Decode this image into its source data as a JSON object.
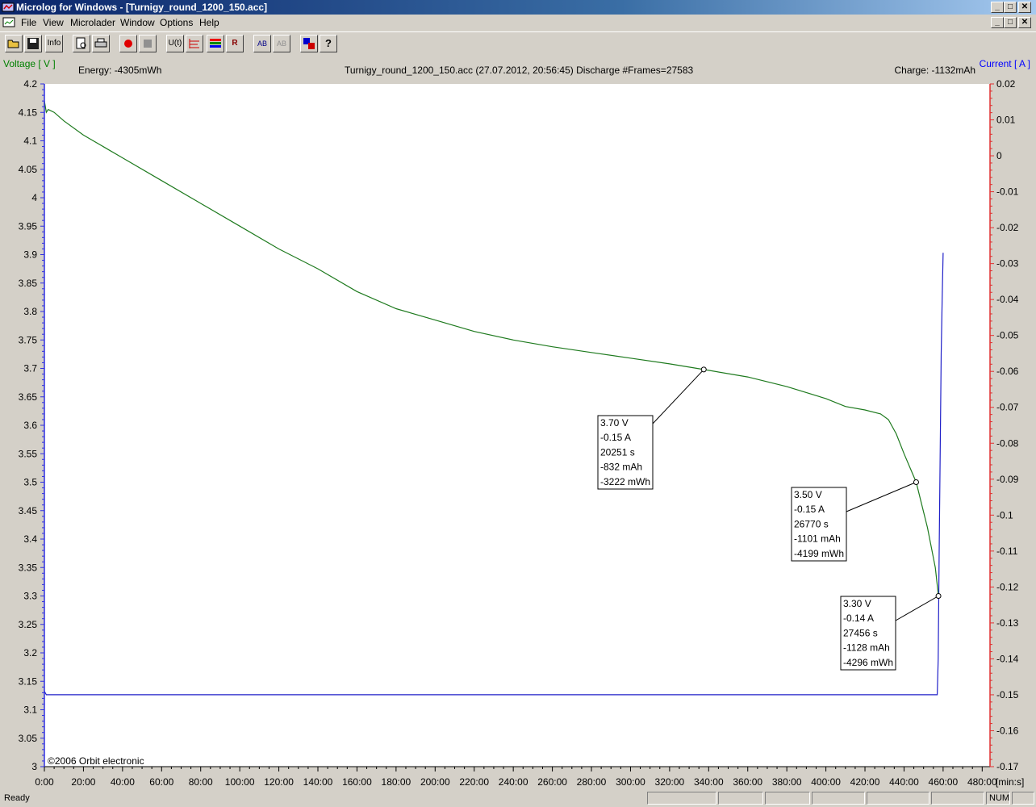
{
  "window": {
    "title": "Microlog for Windows - [Turnigy_round_1200_150.acc]",
    "title_controls": [
      "_",
      "□",
      "✕"
    ],
    "doc_controls": [
      "_",
      "□",
      "✕"
    ]
  },
  "menu": [
    {
      "label": "File",
      "name": "menu-file"
    },
    {
      "label": "View",
      "name": "menu-view"
    },
    {
      "label": "Microlader",
      "name": "menu-microlader"
    },
    {
      "label": "Window",
      "name": "menu-window"
    },
    {
      "label": "Options",
      "name": "menu-options"
    },
    {
      "label": "Help",
      "name": "menu-help"
    }
  ],
  "toolbar": [
    {
      "name": "open-button",
      "icon": "folder-open-icon"
    },
    {
      "name": "save-button",
      "icon": "floppy-disk-icon"
    },
    {
      "name": "info-button",
      "icon": "info-icon",
      "label": "Info"
    },
    {
      "name": "print-preview-button",
      "icon": "print-preview-icon"
    },
    {
      "name": "print-button",
      "icon": "printer-icon"
    },
    {
      "name": "record-button",
      "icon": "record-icon"
    },
    {
      "name": "stop-button",
      "icon": "stop-icon"
    },
    {
      "name": "u-t-button",
      "icon": "u-t-icon",
      "label": "U(t)"
    },
    {
      "name": "scale-button",
      "icon": "scale-icon"
    },
    {
      "name": "colors-button",
      "icon": "color-bars-icon"
    },
    {
      "name": "resistor-button",
      "icon": "resistor-icon",
      "label": "R"
    },
    {
      "name": "ab-button",
      "icon": "ab-compare-icon",
      "label": "AB"
    },
    {
      "name": "ab-disabled-button",
      "icon": "ab-disabled-icon",
      "label": "AB"
    },
    {
      "name": "cursor-button",
      "icon": "cursor-icon"
    },
    {
      "name": "help-button",
      "icon": "help-icon",
      "label": "?"
    }
  ],
  "chart_header": {
    "left_axis_label": "Voltage [ V ]",
    "right_axis_label": "Current [ A ]",
    "energy": "Energy: -4305mWh",
    "file_info": "Turnigy_round_1200_150.acc (27.07.2012, 20:56:45)   Discharge  #Frames=27583",
    "charge": "Charge: -1132mAh",
    "copyright": "©2006 Orbit electronic",
    "x_unit": "[min:s]"
  },
  "colors": {
    "voltage": "#1e7a1e",
    "current": "#2020c8",
    "left_axis": "#3030e0",
    "right_axis": "#e03030",
    "left_label": "#008000",
    "right_label": "#0000ff"
  },
  "chart_data": {
    "type": "line",
    "x_axis": {
      "range_min": [
        0,
        484
      ],
      "ticks": [
        "0:00",
        "20:00",
        "40:00",
        "60:00",
        "80:00",
        "100:00",
        "120:00",
        "140:00",
        "160:00",
        "180:00",
        "200:00",
        "220:00",
        "240:00",
        "260:00",
        "280:00",
        "300:00",
        "320:00",
        "340:00",
        "360:00",
        "380:00",
        "400:00",
        "420:00",
        "440:00",
        "460:00",
        "480:00"
      ]
    },
    "y_left": {
      "label": "Voltage [ V ]",
      "range": [
        3.0,
        4.2
      ],
      "ticks": [
        "4.2",
        "4.15",
        "4.1",
        "4.05",
        "4",
        "3.95",
        "3.9",
        "3.85",
        "3.8",
        "3.75",
        "3.7",
        "3.65",
        "3.6",
        "3.55",
        "3.5",
        "3.45",
        "3.4",
        "3.35",
        "3.3",
        "3.25",
        "3.2",
        "3.15",
        "3.1",
        "3.05",
        "3"
      ]
    },
    "y_right": {
      "label": "Current [ A ]",
      "range": [
        -0.17,
        0.02
      ],
      "ticks": [
        "0.02",
        "0.01",
        "0",
        "-0.01",
        "-0.02",
        "-0.03",
        "-0.04",
        "-0.05",
        "-0.06",
        "-0.07",
        "-0.08",
        "-0.09",
        "-0.1",
        "-0.11",
        "-0.12",
        "-0.13",
        "-0.14",
        "-0.15",
        "-0.16",
        "-0.17"
      ]
    },
    "series": [
      {
        "name": "Voltage [ V ]",
        "axis": "left",
        "points": [
          [
            0,
            4.17
          ],
          [
            1,
            4.15
          ],
          [
            2,
            4.155
          ],
          [
            5,
            4.15
          ],
          [
            10,
            4.135
          ],
          [
            20,
            4.11
          ],
          [
            40,
            4.07
          ],
          [
            60,
            4.03
          ],
          [
            80,
            3.99
          ],
          [
            100,
            3.95
          ],
          [
            120,
            3.91
          ],
          [
            140,
            3.875
          ],
          [
            160,
            3.835
          ],
          [
            180,
            3.805
          ],
          [
            200,
            3.785
          ],
          [
            220,
            3.765
          ],
          [
            240,
            3.75
          ],
          [
            260,
            3.738
          ],
          [
            280,
            3.728
          ],
          [
            300,
            3.718
          ],
          [
            320,
            3.708
          ],
          [
            337.5,
            3.698
          ],
          [
            360,
            3.685
          ],
          [
            380,
            3.668
          ],
          [
            400,
            3.647
          ],
          [
            410,
            3.633
          ],
          [
            420,
            3.627
          ],
          [
            428,
            3.62
          ],
          [
            432,
            3.61
          ],
          [
            436,
            3.585
          ],
          [
            440,
            3.55
          ],
          [
            446.2,
            3.5
          ],
          [
            452,
            3.42
          ],
          [
            456,
            3.35
          ],
          [
            457.6,
            3.3
          ]
        ]
      },
      {
        "name": "Current [ A ]",
        "axis": "right",
        "points": [
          [
            0,
            -0.149
          ],
          [
            1,
            -0.15
          ],
          [
            457,
            -0.15
          ],
          [
            457.5,
            -0.14
          ],
          [
            458,
            -0.11
          ],
          [
            459,
            -0.055
          ],
          [
            459.5,
            -0.04
          ],
          [
            460,
            -0.027
          ]
        ]
      }
    ],
    "annotations": [
      {
        "x": 337.5,
        "y": 3.698,
        "lines": [
          "3.70 V",
          "-0.15 A",
          "20251 s",
          "-832 mAh",
          "-3222 mWh"
        ]
      },
      {
        "x": 446.2,
        "y": 3.5,
        "lines": [
          "3.50 V",
          "-0.15 A",
          "26770 s",
          "-1101 mAh",
          "-4199 mWh"
        ]
      },
      {
        "x": 457.6,
        "y": 3.3,
        "lines": [
          "3.30 V",
          "-0.14 A",
          "27456 s",
          "-1128 mAh",
          "-4296 mWh"
        ]
      }
    ]
  },
  "status": {
    "ready": "Ready",
    "num": "NUM"
  }
}
